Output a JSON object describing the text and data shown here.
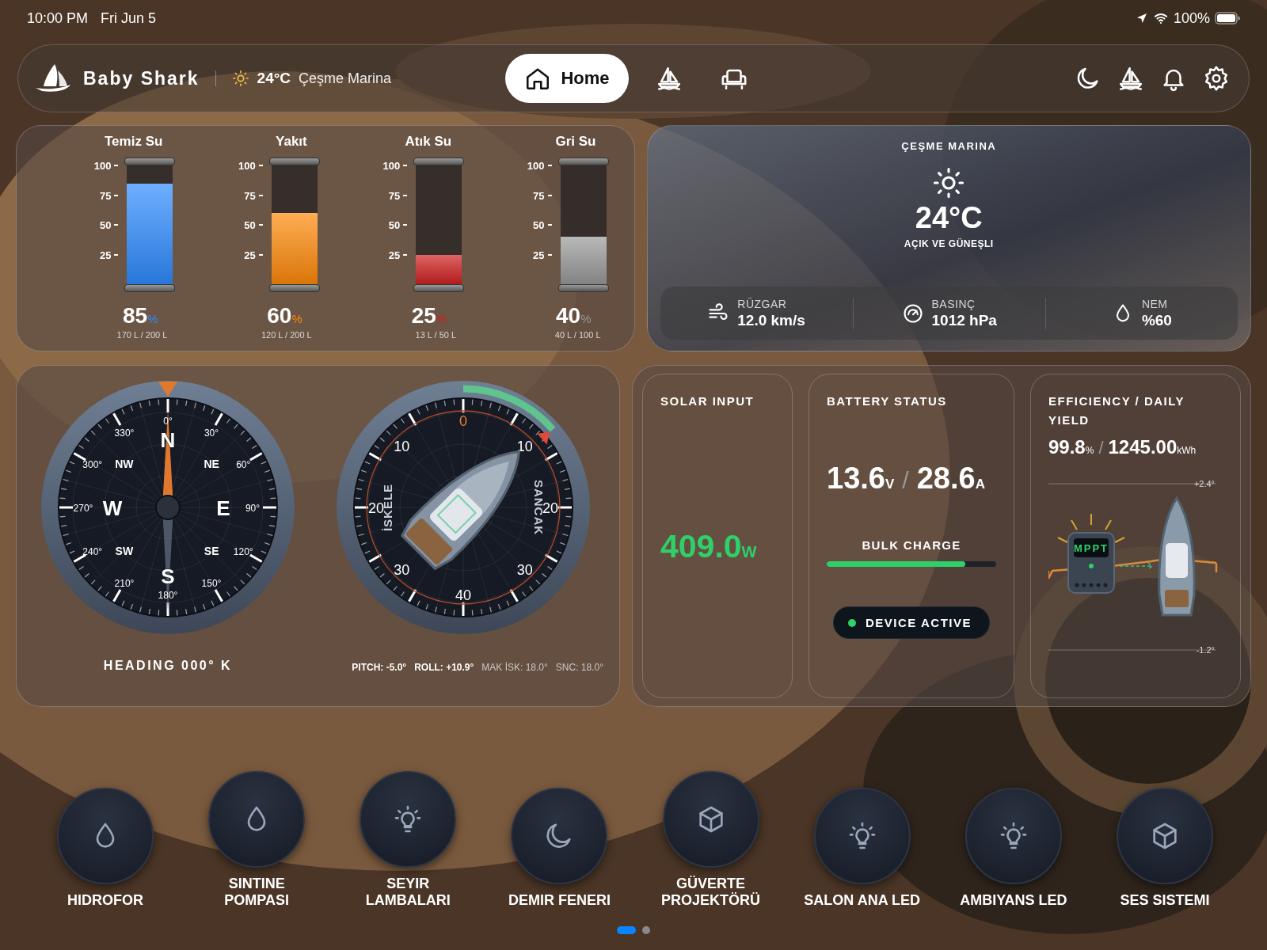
{
  "status_bar": {
    "time": "10:00 PM",
    "date": "Fri Jun 5",
    "battery": "100%"
  },
  "nav": {
    "brand": "Baby Shark",
    "temperature": "24°C",
    "location": "Çeşme Marina",
    "tabs": [
      {
        "kind": "home",
        "label": "Home",
        "selected": true
      },
      {
        "kind": "sailboat",
        "selected": false
      },
      {
        "kind": "armchair",
        "selected": false
      }
    ]
  },
  "tanks": [
    {
      "name": "Temiz Su",
      "scale": [
        "100",
        "75",
        "50",
        "25"
      ],
      "level": 0.85,
      "percent": "85",
      "unit": "%",
      "capacity": "170 L / 200 L",
      "color": "#2f8cff"
    },
    {
      "name": "Yakıt",
      "scale": [
        "100",
        "75",
        "50",
        "25"
      ],
      "level": 0.6,
      "percent": "60",
      "unit": "%",
      "capacity": "120 L / 200 L",
      "color": "#ff8a0a"
    },
    {
      "name": "Atık Su",
      "scale": [
        "100",
        "75",
        "50",
        "25"
      ],
      "level": 0.25,
      "percent": "25",
      "unit": "%",
      "capacity": "13 L / 50 L",
      "color": "#d02020"
    },
    {
      "name": "Gri Su",
      "scale": [
        "100",
        "75",
        "50",
        "25"
      ],
      "level": 0.4,
      "percent": "40",
      "unit": "%",
      "capacity": "40 L / 100 L",
      "color": "#9a9a9a"
    }
  ],
  "weather": {
    "location": "ÇEŞME MARINA",
    "temperature": "24°C",
    "condition": "AÇIK VE GÜNEŞLI",
    "stats": [
      {
        "kind": "wind",
        "label": "RÜZGAR",
        "value": "12.0 km/s"
      },
      {
        "kind": "pressure",
        "label": "BASINÇ",
        "value": "1012 hPa"
      },
      {
        "kind": "humidity",
        "label": "NEM",
        "value": "%60"
      }
    ]
  },
  "compass": {
    "degree_labels": [
      "0°",
      "30°",
      "60°",
      "90°",
      "120°",
      "150°",
      "180°",
      "210°",
      "240°",
      "270°",
      "300°",
      "330°"
    ],
    "points": [
      "N",
      "NE",
      "E",
      "SE",
      "S",
      "SW",
      "W",
      "NW"
    ],
    "heading": "HEADING 000° K"
  },
  "inclinometer": {
    "scale_labels": [
      "0",
      "10",
      "20",
      "30",
      "40",
      "30",
      "20",
      "10"
    ],
    "port_label": "İSKELE",
    "starboard_label": "SANCAK",
    "readouts": [
      {
        "text": "PITCH: -5.0°",
        "kind": "primary"
      },
      {
        "text": "ROLL: +10.9°",
        "kind": "primary"
      },
      {
        "text": "MAK İSK: 18.0°",
        "kind": "secondary"
      },
      {
        "text": "SNC: 18.0°",
        "kind": "secondary"
      }
    ]
  },
  "solar": {
    "title": "SOLAR INPUT",
    "value": "409.0",
    "unit": "W"
  },
  "battery": {
    "title": "BATTERY STATUS",
    "voltage": "13.6",
    "voltage_unit": "V",
    "separator": "/",
    "current": "28.6",
    "current_unit": "A",
    "charge_label": "BULK CHARGE",
    "level": 0.82,
    "device_status": "DEVICE ACTIVE",
    "active": true
  },
  "efficiency": {
    "title": "EFFICIENCY / DAILY YIELD",
    "efficiency": "99.8",
    "efficiency_unit": "%",
    "separator": "/",
    "yield": "1245.00",
    "yield_unit": "kWh",
    "top_mark": "+2.4°",
    "bottom_mark": "-1.2°",
    "mppt_label": "MPPT"
  },
  "controls": [
    {
      "label": "HIDROFOR",
      "kind": "drop"
    },
    {
      "label": "SINTINE\nPOMPASI",
      "kind": "drop"
    },
    {
      "label": "SEYIR\nLAMBALARI",
      "kind": "bulb"
    },
    {
      "label": "DEMIR FENERI",
      "kind": "moon"
    },
    {
      "label": "GÜVERTE\nPROJEKTÖRÜ",
      "kind": "box"
    },
    {
      "label": "SALON ANA LED",
      "kind": "bulb"
    },
    {
      "label": "AMBIYANS LED",
      "kind": "bulb"
    },
    {
      "label": "SES SISTEMI",
      "kind": "box"
    }
  ],
  "pages": [
    {
      "selected": true
    },
    {
      "selected": false
    }
  ]
}
